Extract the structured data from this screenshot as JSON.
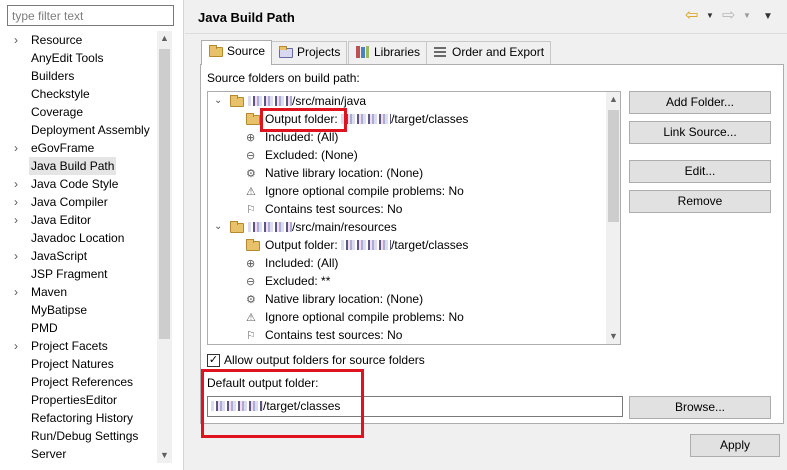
{
  "filter": {
    "placeholder": "type filter text"
  },
  "pref_tree": {
    "items": [
      {
        "label": "Resource",
        "expandable": true
      },
      {
        "label": "AnyEdit Tools",
        "expandable": false
      },
      {
        "label": "Builders",
        "expandable": false
      },
      {
        "label": "Checkstyle",
        "expandable": false
      },
      {
        "label": "Coverage",
        "expandable": false
      },
      {
        "label": "Deployment Assembly",
        "expandable": false
      },
      {
        "label": "eGovFrame",
        "expandable": true
      },
      {
        "label": "Java Build Path",
        "expandable": false,
        "selected": true
      },
      {
        "label": "Java Code Style",
        "expandable": true
      },
      {
        "label": "Java Compiler",
        "expandable": true
      },
      {
        "label": "Java Editor",
        "expandable": true
      },
      {
        "label": "Javadoc Location",
        "expandable": false
      },
      {
        "label": "JavaScript",
        "expandable": true
      },
      {
        "label": "JSP Fragment",
        "expandable": false
      },
      {
        "label": "Maven",
        "expandable": true
      },
      {
        "label": "MyBatipse",
        "expandable": false
      },
      {
        "label": "PMD",
        "expandable": false
      },
      {
        "label": "Project Facets",
        "expandable": true
      },
      {
        "label": "Project Natures",
        "expandable": false
      },
      {
        "label": "Project References",
        "expandable": false
      },
      {
        "label": "PropertiesEditor",
        "expandable": false
      },
      {
        "label": "Refactoring History",
        "expandable": false
      },
      {
        "label": "Run/Debug Settings",
        "expandable": false
      },
      {
        "label": "Server",
        "expandable": false
      }
    ]
  },
  "header": {
    "title": "Java Build Path"
  },
  "tabs": [
    {
      "label": "Source",
      "active": true
    },
    {
      "label": "Projects"
    },
    {
      "label": "Libraries"
    },
    {
      "label": "Order and Export"
    }
  ],
  "source_tab": {
    "folders_label": "Source folders on build path:",
    "folders": [
      {
        "path_suffix": "/src/main/java",
        "properties": [
          {
            "key": "Output folder:",
            "value": "/target/classes",
            "obscured_prefix": true
          },
          {
            "key": "Included:",
            "value": "(All)"
          },
          {
            "key": "Excluded:",
            "value": "(None)"
          },
          {
            "key": "Native library location:",
            "value": "(None)"
          },
          {
            "key": "Ignore optional compile problems:",
            "value": "No"
          },
          {
            "key": "Contains test sources:",
            "value": "No"
          }
        ]
      },
      {
        "path_suffix": "/src/main/resources",
        "properties": [
          {
            "key": "Output folder:",
            "value": "/target/classes",
            "obscured_prefix": true
          },
          {
            "key": "Included:",
            "value": "(All)"
          },
          {
            "key": "Excluded:",
            "value": "**"
          },
          {
            "key": "Native library location:",
            "value": "(None)"
          },
          {
            "key": "Ignore optional compile problems:",
            "value": "No"
          },
          {
            "key": "Contains test sources:",
            "value": "No"
          }
        ]
      }
    ],
    "buttons": {
      "add_folder": "Add Folder...",
      "link_source": "Link Source...",
      "edit": "Edit...",
      "remove": "Remove",
      "browse": "Browse..."
    },
    "allow_output": {
      "label": "Allow output folders for source folders",
      "checked": true
    },
    "default_output_label": "Default output folder:",
    "default_output_value": "/target/classes"
  },
  "footer": {
    "apply_label": "Apply"
  },
  "colors": {
    "highlight": "#e0141e",
    "folder": "#e8c26a"
  }
}
